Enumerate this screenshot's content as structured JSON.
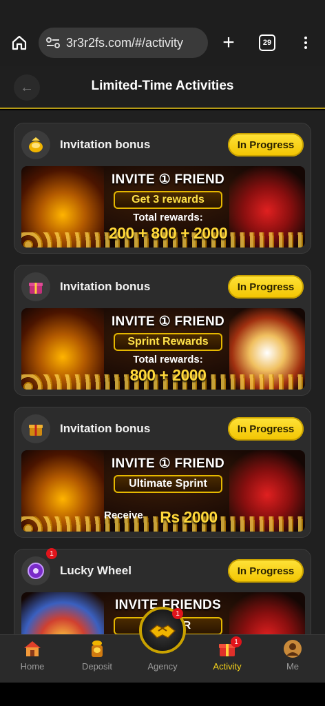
{
  "browser": {
    "url": "3r3r2fs.com/#/activity",
    "tab_count": "29"
  },
  "header": {
    "title": "Limited-Time Activities"
  },
  "cards": [
    {
      "title": "Invitation bonus",
      "status": "In Progress",
      "icon": "gold-bag-icon",
      "banner": {
        "line1": "INVITE ① FRIEND",
        "line2": "Get 3 rewards",
        "line3": "Total rewards:",
        "line4": "200 + 800 + 2000"
      }
    },
    {
      "title": "Invitation bonus",
      "status": "In Progress",
      "icon": "gift-box-icon",
      "banner": {
        "line1": "INVITE ① FRIEND",
        "line2": "Sprint Rewards",
        "line3": "Total rewards:",
        "line4": "800 + 2000"
      }
    },
    {
      "title": "Invitation bonus",
      "status": "In Progress",
      "icon": "gift-box-icon",
      "banner": {
        "line1": "INVITE ① FRIEND",
        "line2": "Ultimate Sprint",
        "line3": "Receive",
        "line4": "Rs 2000"
      }
    },
    {
      "title": "Lucky Wheel",
      "status": "In Progress",
      "icon": "purple-wheel-icon",
      "badge": "1",
      "banner": {
        "line1": "INVITE FRIENDS",
        "line2": "TO ... ER",
        "line3": "",
        "line4": ""
      }
    }
  ],
  "nav": {
    "items": [
      {
        "label": "Home",
        "icon": "home-icon"
      },
      {
        "label": "Deposit",
        "icon": "deposit-icon"
      },
      {
        "label": "Agency",
        "icon": "agency-handshake-icon",
        "badge": "1"
      },
      {
        "label": "Activity",
        "icon": "gift-icon",
        "badge": "1",
        "active": true
      },
      {
        "label": "Me",
        "icon": "avatar-icon"
      }
    ]
  },
  "colors": {
    "accent": "#f5d21a",
    "background": "#202020",
    "card": "#2c2c2c",
    "badge": "#e0141b"
  }
}
